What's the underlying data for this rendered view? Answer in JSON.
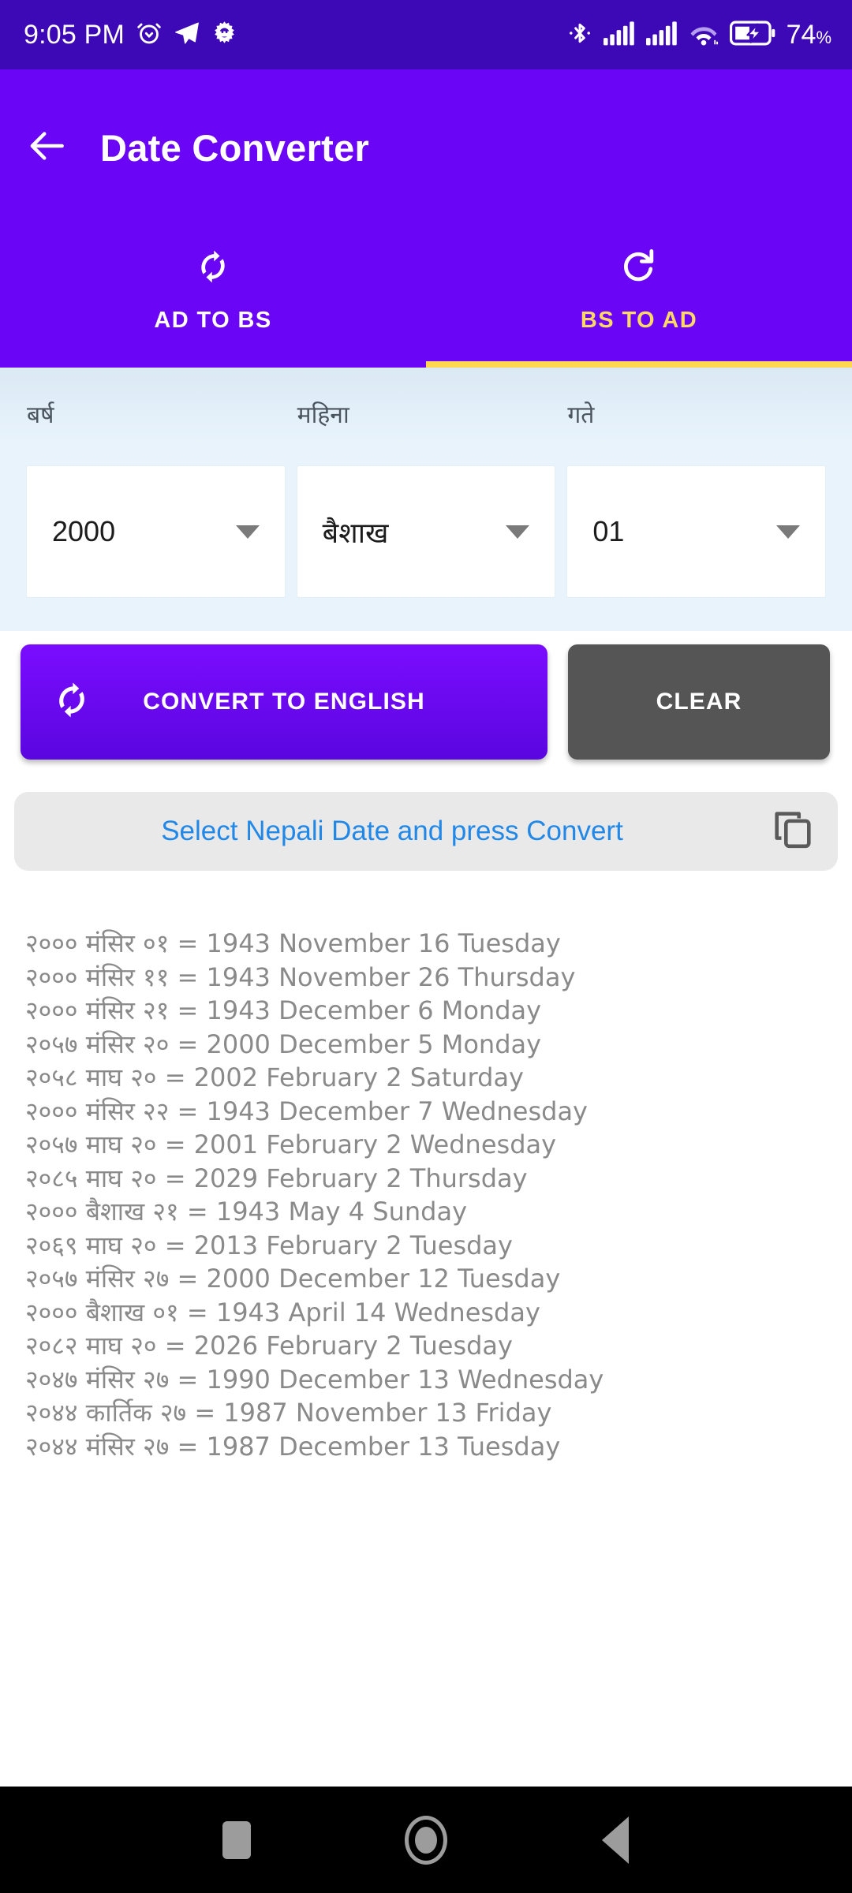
{
  "statusbar": {
    "time": "9:05 PM",
    "battery_percent": "74",
    "percent_symbol": "%",
    "icons": [
      "alarm-icon",
      "telegram-icon",
      "gear-icon",
      "bluetooth-icon",
      "signal-sim1-icon",
      "signal-sim2-icon",
      "wifi-icon",
      "battery-charging-icon"
    ],
    "colors": {
      "background": "#3d08b5",
      "foreground": "#ffffff"
    }
  },
  "appbar": {
    "title": "Date Converter",
    "back_icon": "arrow-left-icon",
    "color": "#6a05f5"
  },
  "tabs": {
    "items": [
      {
        "label": "AD TO BS",
        "icon": "sync-icon",
        "active": false
      },
      {
        "label": "BS TO AD",
        "icon": "refresh-icon",
        "active": true
      }
    ],
    "active_index": 1,
    "active_color": "#fcd965",
    "inactive_color": "#ffffff",
    "indicator_color": "#fcd74f"
  },
  "form": {
    "background": "#e8f3fc",
    "fields": [
      {
        "label": "बर्ष",
        "value": "2000",
        "caret_icon": "chevron-down-icon"
      },
      {
        "label": "महिना",
        "value": "बैशाख",
        "caret_icon": "chevron-down-icon"
      },
      {
        "label": "गते",
        "value": "01",
        "caret_icon": "chevron-down-icon"
      }
    ]
  },
  "actions": {
    "convert_label": "CONVERT TO ENGLISH",
    "convert_icon": "sync-icon",
    "convert_color": "#6a05f5",
    "clear_label": "CLEAR",
    "clear_color": "#555555"
  },
  "result": {
    "text": "Select Nepali Date and press Convert",
    "text_color": "#2288e8",
    "background": "#e9e9e9",
    "copy_icon": "copy-icon"
  },
  "history": {
    "text_color": "#8a8a8a",
    "rows": [
      "२००० मंसिर ०१ = 1943 November 16 Tuesday",
      "२००० मंसिर ११ = 1943 November 26 Thursday",
      "२००० मंसिर २१ = 1943 December 6 Monday",
      "२०५७ मंसिर २० = 2000 December 5 Monday",
      "२०५८ माघ २० = 2002 February 2 Saturday",
      "२००० मंसिर २२ = 1943 December 7 Wednesday",
      "२०५७ माघ २० = 2001 February 2 Wednesday",
      "२०८५ माघ २० = 2029 February 2 Thursday",
      "२००० बैशाख २१ = 1943 May 4 Sunday",
      "२०६९ माघ २० = 2013 February 2 Tuesday",
      "२०५७ मंसिर २७ = 2000 December 12 Tuesday",
      "२००० बैशाख ०१ = 1943 April 14 Wednesday",
      "२०८२ माघ २० = 2026 February 2 Tuesday",
      "२०४७ मंसिर २७ = 1990 December 13 Wednesday",
      "२०४४ कार्तिक २७ = 1987 November 13 Friday",
      "२०४४ मंसिर २७ = 1987 December 13 Tuesday"
    ]
  },
  "navbar": {
    "background": "#000000",
    "items": [
      "recents-square-icon",
      "home-circle-icon",
      "back-triangle-icon"
    ]
  }
}
